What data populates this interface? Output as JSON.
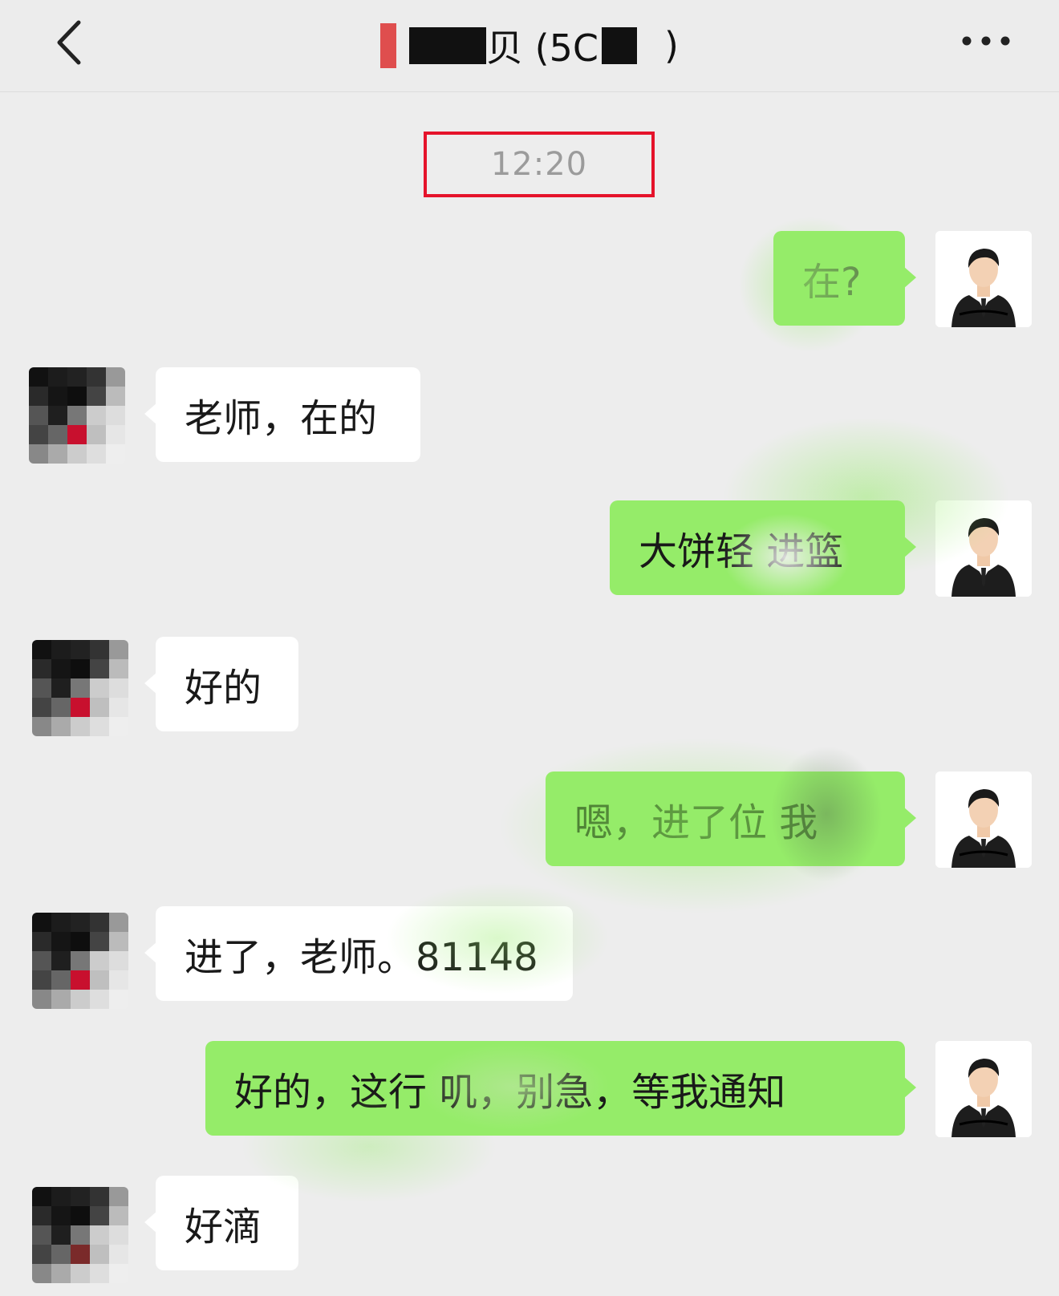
{
  "header": {
    "back_icon": "chevron-left-icon",
    "title_visible": "贝 (5C",
    "title_suffix": ")",
    "more_icon": "ellipsis-icon"
  },
  "timestamp": "12:20",
  "messages": [
    {
      "side": "out",
      "text": "在?"
    },
    {
      "side": "in",
      "text": "老师，在的"
    },
    {
      "side": "out",
      "text": "大饼轻 进篮"
    },
    {
      "side": "in",
      "text": "好的"
    },
    {
      "side": "out",
      "text": "嗯，进了位 我"
    },
    {
      "side": "in",
      "text": "进了，老师。81148"
    },
    {
      "side": "out",
      "text": "好的，这行 叽，别急，等我通知"
    },
    {
      "side": "in",
      "text": "好滴"
    }
  ],
  "colors": {
    "background": "#ededed",
    "outgoing_bubble": "#95ec69",
    "incoming_bubble": "#ffffff",
    "highlight_box": "#e5132b"
  }
}
